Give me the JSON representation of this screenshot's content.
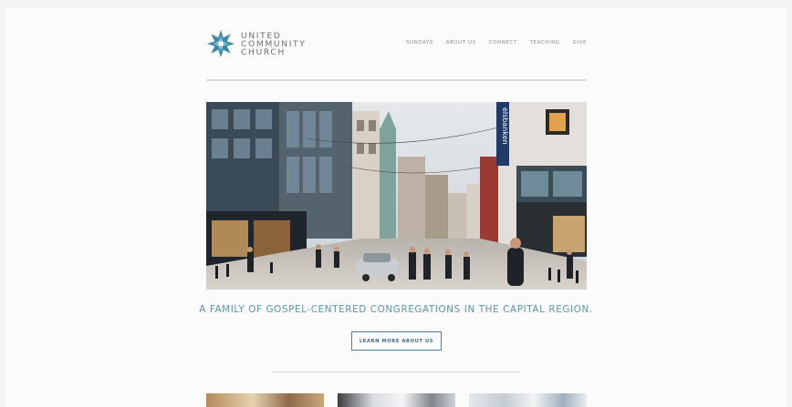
{
  "brand": {
    "line1": "UNITED",
    "line2": "COMMUNITY",
    "line3": "CHURCH",
    "color": "#3d87a8"
  },
  "nav": {
    "items": [
      "SUNDAYS",
      "ABOUT US",
      "CONNECT",
      "TEACHING",
      "GIVE"
    ]
  },
  "hero": {
    "sign_text": "elsbanken"
  },
  "tagline": "A FAMILY OF GOSPEL-CENTERED CONGREGATIONS IN THE CAPITAL REGION.",
  "cta": {
    "label": "LEARN MORE ABOUT US"
  },
  "colors": {
    "accent": "#5b95a4",
    "button_border": "#4b7f9c"
  }
}
